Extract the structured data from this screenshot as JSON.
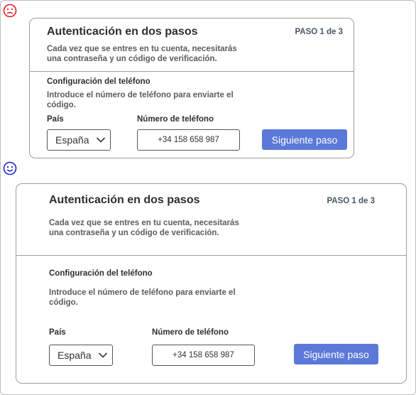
{
  "bad_example": {
    "indicator_icon": "sad-face-icon",
    "indicator_color": "#e02020",
    "card": {
      "title": "Autenticación en dos pasos",
      "step": "PASO 1 de 3",
      "description_line1": "Cada vez que se entres en tu cuenta, necesitarás",
      "description_line2": "una contraseña y un código de verificación.",
      "section_title": "Configuración del teléfono",
      "section_desc_line1": "Introduce el número de teléfono para enviarte el",
      "section_desc_line2": "código.",
      "country_label": "País",
      "country_value": "España",
      "phone_label": "Número de teléfono",
      "phone_value": "+34 158 658 987",
      "next_button": "Siguiente paso"
    }
  },
  "good_example": {
    "indicator_icon": "happy-face-icon",
    "indicator_color": "#2020d0",
    "card": {
      "title": "Autenticación en dos pasos",
      "step": "PASO 1 de 3",
      "description_line1": "Cada vez que se entres en tu cuenta, necesitarás",
      "description_line2": "una contraseña y un código de verificación.",
      "section_title": "Configuración del teléfono",
      "section_desc_line1": "Introduce el número de teléfono para enviarte el",
      "section_desc_line2": "código.",
      "country_label": "País",
      "country_value": "España",
      "phone_label": "Número de teléfono",
      "phone_value": "+34 158 658 987",
      "next_button": "Siguiente paso"
    }
  },
  "colors": {
    "button": "#5b79d9",
    "border": "#9e9e9e"
  }
}
